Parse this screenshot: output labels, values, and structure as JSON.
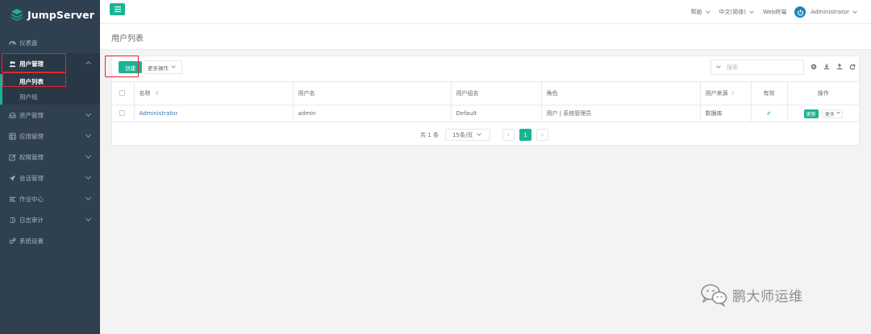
{
  "app": {
    "logo_text": "JumpServer"
  },
  "sidebar": {
    "items": [
      {
        "label": "仪表盘",
        "icon": "dashboard-icon"
      },
      {
        "label": "用户管理",
        "icon": "users-icon",
        "expanded": true,
        "children": [
          {
            "label": "用户列表",
            "current": true
          },
          {
            "label": "用户组"
          }
        ]
      },
      {
        "label": "资产管理",
        "icon": "inbox-icon"
      },
      {
        "label": "应用管理",
        "icon": "grid-icon"
      },
      {
        "label": "权限管理",
        "icon": "edit-icon"
      },
      {
        "label": "会话管理",
        "icon": "paper-plane-icon"
      },
      {
        "label": "作业中心",
        "icon": "bars-icon"
      },
      {
        "label": "日志审计",
        "icon": "history-icon"
      },
      {
        "label": "系统设置",
        "icon": "gears-icon"
      }
    ]
  },
  "topbar": {
    "help": "帮助",
    "language": "中文(简体)",
    "web_terminal": "Web终端",
    "user": "Administrator"
  },
  "page": {
    "title": "用户列表"
  },
  "toolbar": {
    "create_label": "创建",
    "more_actions_label": "更多操作",
    "search_placeholder": "搜索"
  },
  "table": {
    "headers": [
      "名称",
      "用户名",
      "用户组名",
      "角色",
      "用户来源",
      "有效",
      "操作"
    ],
    "rows": [
      {
        "name": "Administrator",
        "username": "admin",
        "group": "Default",
        "role": "用户 | 系统管理员",
        "source": "数据库",
        "valid": "✔",
        "update_label": "更新",
        "more_label": "更多"
      }
    ]
  },
  "pagination": {
    "total_text": "共 1 条",
    "page_size": "15条/页",
    "current_page": "1"
  },
  "watermark": {
    "text": "鹏大师运维"
  },
  "colors": {
    "accent": "#1ab394",
    "sidebar_bg": "#2f4050",
    "highlight": "#e3262f"
  }
}
